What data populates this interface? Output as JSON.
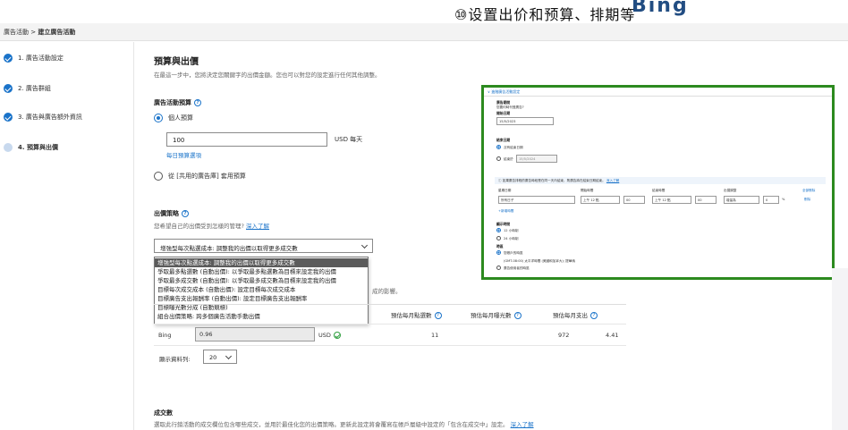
{
  "header": {
    "annotation": "⑩设置出价和预算、排期等",
    "brand_text": "Bing"
  },
  "breadcrumb": {
    "parent": "廣告活動 >",
    "current": "建立廣告活動"
  },
  "steps": [
    {
      "label": "1. 廣告活動設定",
      "state": "done"
    },
    {
      "label": "2. 廣告群組",
      "state": "done"
    },
    {
      "label": "3. 廣告與廣告額外資訊",
      "state": "done"
    },
    {
      "label": "4. 預算與出價",
      "state": "active"
    }
  ],
  "main": {
    "title": "預算與出價",
    "description": "在最這一步中，您將決定您關鍵字的出價金額。您也可以對您的設定進行任何其他調整。",
    "budget_heading": "廣告活動預算",
    "budget_option_individual": "個人預算",
    "budget_value": "100",
    "budget_unit": "USD 每天",
    "budget_link": "每日預算選項",
    "budget_option_shared": "從 [共用的廣告庫] 套用預算",
    "bid_strategy_heading": "出價策略",
    "bid_strategy_question": "您希望自己的出價受到怎樣的管理?",
    "learn_more": "深入了解",
    "bid_strategy_selected": "增強型每次點選成本: 調整我的出價以取得更多成交數",
    "bid_strategy_options": [
      "增強型每次點選成本: 調整我的出價以取得更多成交數",
      "爭取最多點選數 (自動出價): 以爭取最多點選數為目標來設定我的出價",
      "爭取最多成交數 (自動出價): 以爭取最多成交數為目標來設定我的出價",
      "目標每次成交成本 (自動出價): 設定目標每次成交成本",
      "目標廣告支出報酬率 (自動出價): 設定目標廣告支出報酬率",
      "目標曝光數分成 (自動競標)",
      "組合出價策略: 跨多個廣告活動手動出價"
    ],
    "impact_text_tail": "成的影響。",
    "estimate_headers": [
      "預估每月點選數",
      "預估每月曝光數",
      "預估每月支出"
    ],
    "estimate_row": {
      "network": "Bing",
      "bid": "0.96",
      "currency": "USD",
      "clicks": "11",
      "impressions": "972",
      "spend": "4.41"
    },
    "rows_label": "顯示資料列:",
    "rows_value": "20",
    "conversions_heading": "成交數",
    "conversions_desc": "選取此行銷活動的成交欄位包含哪些成交，並用於最佳化您的出價策略。更新此設定將會覆寫在帳戶層級中設定的「包含在成交中」設定。",
    "conversions_learn_more": "深入了解"
  },
  "zoom_panel": {
    "header": "進階廣告活動設定",
    "campaign_dates_label": "廣告期間",
    "campaign_dates_q": "您要何時刊登廣告?",
    "start_label": "開始日期",
    "start_value": "15/5/2023",
    "end_label": "結束日期",
    "end_option_none": "沒有結束日期",
    "end_option_date": "結束於",
    "end_date_value": "15/5/2024",
    "schedule_info": "如果廣告排程的廣告時段是在同一天內結束，則廣告將在結束日期結束。",
    "schedule_link": "深入了解",
    "schedule_cols": [
      "星期日期",
      "開始時間",
      "結束時間",
      "出價調整"
    ],
    "schedule_row": [
      "所有日子",
      "上午 12 點",
      "00",
      "上午 12 點",
      "00",
      "增量為",
      "0"
    ],
    "delete_all": "全部刪除",
    "delete": "刪除",
    "add_schedule": "+新增時間",
    "time_display_label": "顯示時間",
    "time_12h": "12 小時制",
    "time_24h": "24 小時制",
    "timezone_label": "時區",
    "timezone_option_account": "您帳戶的時區",
    "timezone_value": "(GMT-08:00) 太平洋時間 (美國和加拿大); 提華納",
    "timezone_option_user": "廣告使用者的時區"
  }
}
